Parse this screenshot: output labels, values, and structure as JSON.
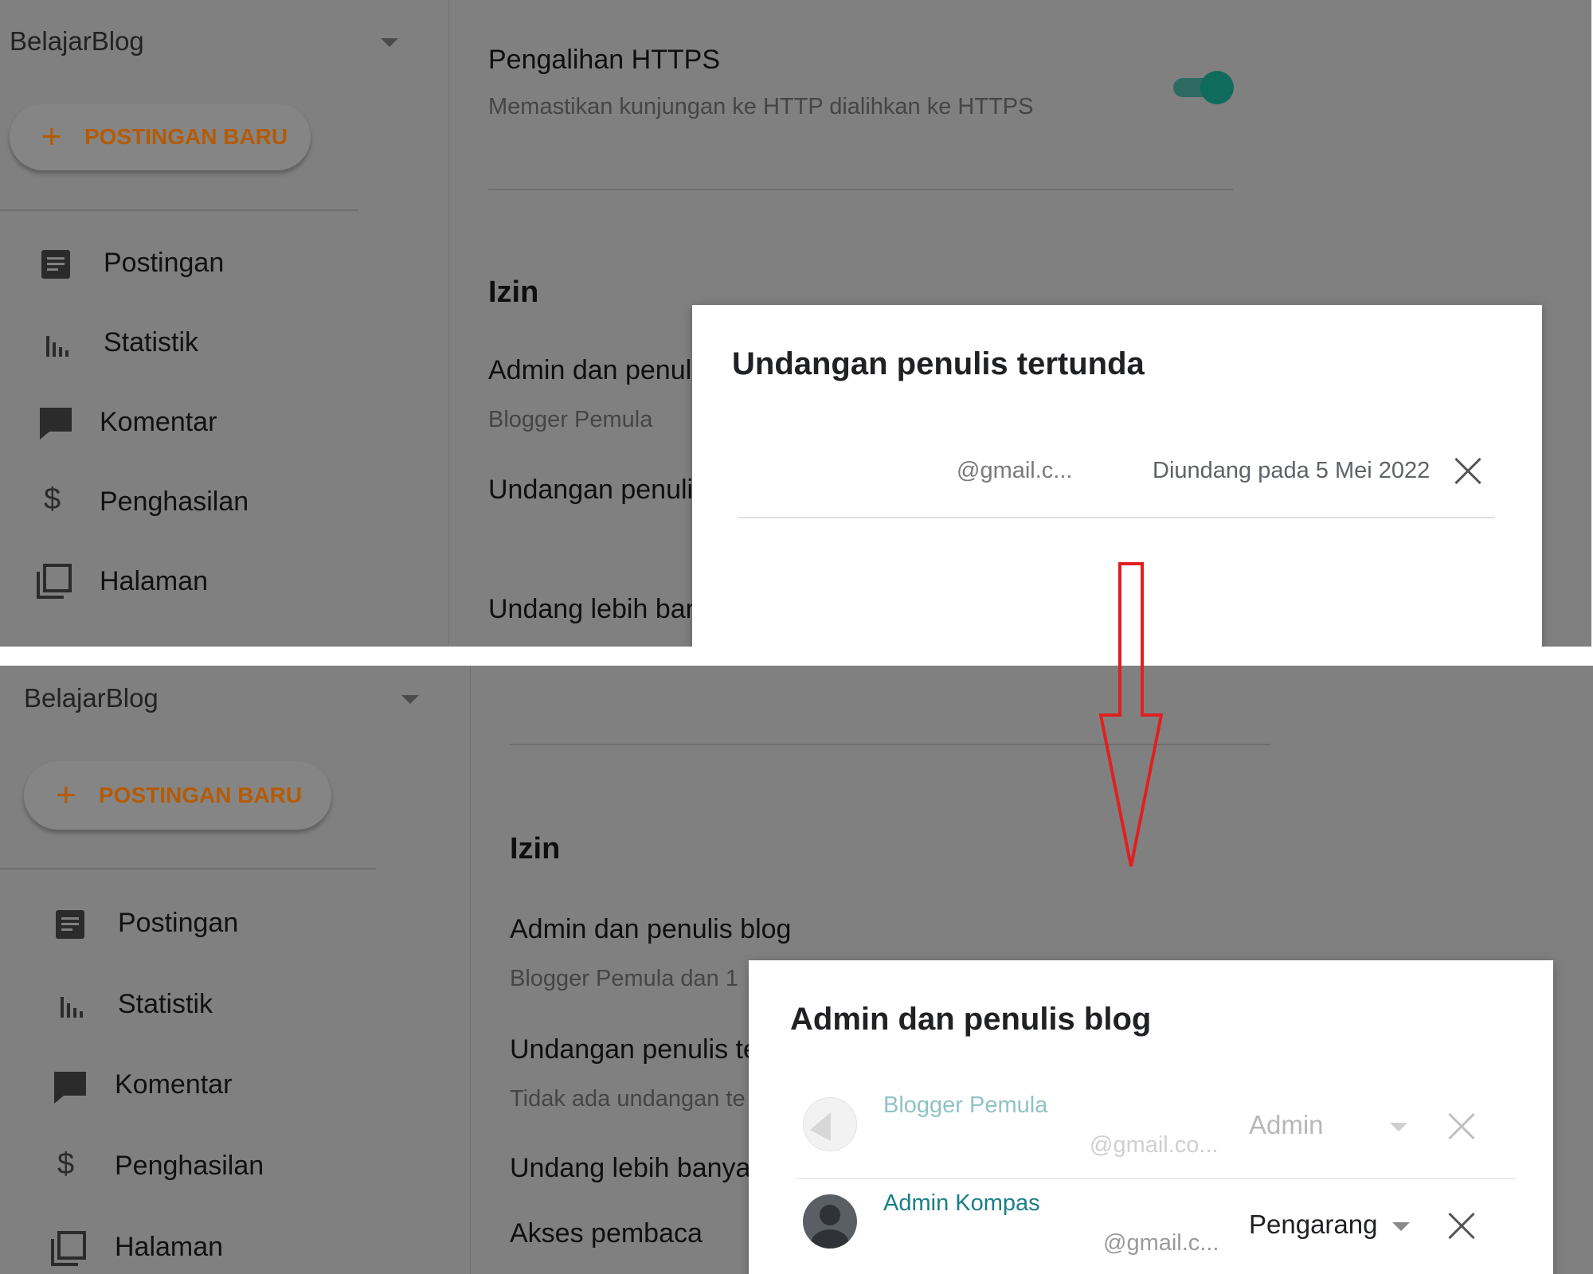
{
  "top": {
    "sidebar": {
      "blog_name": "BelajarBlog",
      "new_post_label": "POSTINGAN BARU",
      "items": [
        {
          "label": "Postingan",
          "icon": "post-icon"
        },
        {
          "label": "Statistik",
          "icon": "stats-icon"
        },
        {
          "label": "Komentar",
          "icon": "comment-icon"
        },
        {
          "label": "Penghasilan",
          "icon": "dollar-icon"
        },
        {
          "label": "Halaman",
          "icon": "page-icon"
        }
      ]
    },
    "main": {
      "https_title": "Pengalihan HTTPS",
      "https_desc": "Memastikan kunjungan ke HTTP dialihkan ke HTTPS",
      "https_enabled": true,
      "section": "Izin",
      "admin_title": "Admin dan penuli",
      "admin_sub": "Blogger Pemula",
      "invites_title": "Undangan penulis",
      "invite_more": "Undang lebih ban"
    },
    "dialog": {
      "title": "Undangan penulis tertunda",
      "email": "@gmail.c...",
      "invited_on": "Diundang pada 5 Mei 2022"
    }
  },
  "bottom": {
    "sidebar": {
      "blog_name": "BelajarBlog",
      "new_post_label": "POSTINGAN BARU",
      "items": [
        {
          "label": "Postingan",
          "icon": "post-icon"
        },
        {
          "label": "Statistik",
          "icon": "stats-icon"
        },
        {
          "label": "Komentar",
          "icon": "comment-icon"
        },
        {
          "label": "Penghasilan",
          "icon": "dollar-icon"
        },
        {
          "label": "Halaman",
          "icon": "page-icon"
        }
      ]
    },
    "main": {
      "section": "Izin",
      "admin_title": "Admin dan penulis blog",
      "admin_sub": "Blogger Pemula dan 1",
      "invites_title": "Undangan penulis te",
      "invites_sub": "Tidak ada undangan te",
      "invite_more": "Undang lebih banya",
      "reader_access": "Akses pembaca"
    },
    "dialog": {
      "title": "Admin dan penulis blog",
      "users": [
        {
          "name": "Blogger Pemula",
          "email": "@gmail.co...",
          "role": "Admin",
          "faded": true
        },
        {
          "name": "Admin Kompas",
          "email": "@gmail.c...",
          "role": "Pengarang",
          "faded": false
        }
      ]
    }
  },
  "colors": {
    "accent_orange": "#b45b05",
    "link_teal": "#1a7f86",
    "toggle": "#0f6b5b",
    "arrow": "#e02020"
  }
}
